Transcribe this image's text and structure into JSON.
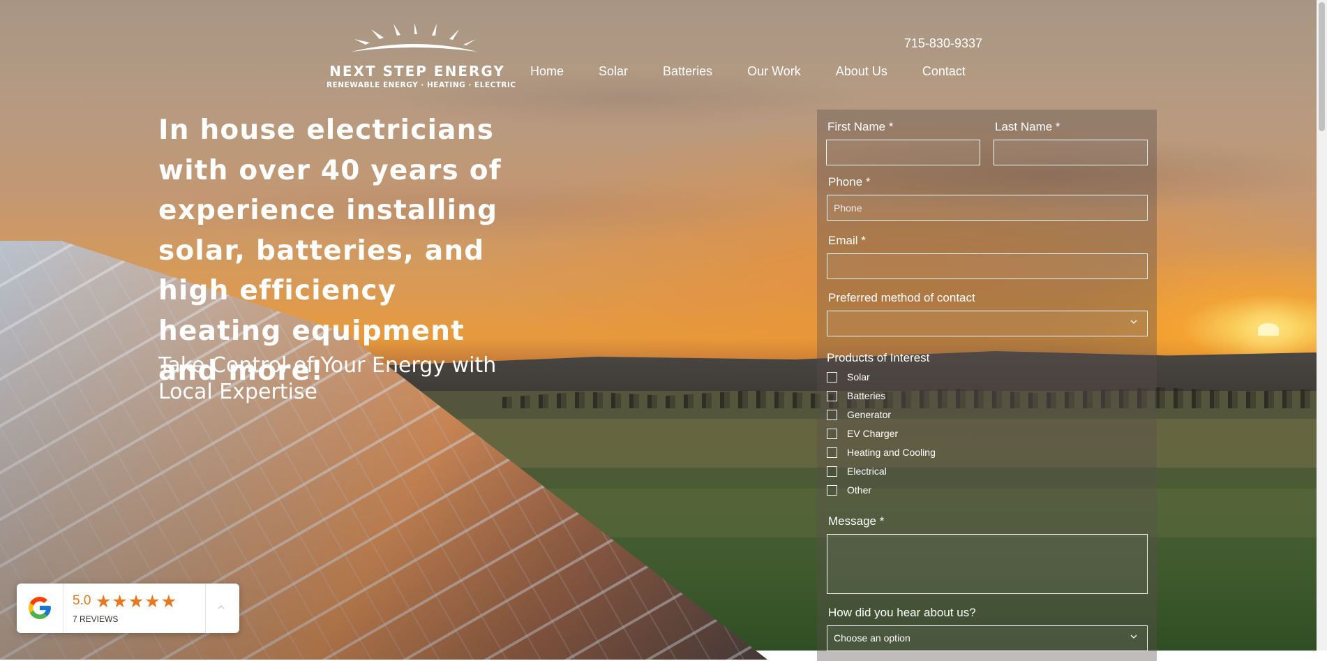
{
  "logo": {
    "title": "NEXT STEP ENERGY",
    "tagline": "RENEWABLE ENERGY · HEATING · ELECTRIC"
  },
  "header": {
    "phone": "715-830-9337",
    "nav": [
      "Home",
      "Solar",
      "Batteries",
      "Our Work",
      "About Us",
      "Contact"
    ]
  },
  "hero": {
    "title": "In house electricians with over 40 years of experience installing solar, batteries, and high efficiency heating equipment and more!",
    "subtitle": "Take Control of Your Energy with Local Expertise"
  },
  "form": {
    "first_name_label": "First Name *",
    "last_name_label": "Last Name *",
    "phone_label": "Phone *",
    "phone_placeholder": "Phone",
    "email_label": "Email *",
    "contact_method_label": "Preferred method of contact",
    "contact_method_value": "",
    "products_label": "Products of Interest",
    "products": [
      "Solar",
      "Batteries",
      "Generator",
      "EV Charger",
      "Heating and Cooling",
      "Electrical",
      "Other"
    ],
    "message_label": "Message *",
    "hear_label": "How did you hear about us?",
    "hear_value": "Choose an option"
  },
  "reviews": {
    "score": "5.0",
    "stars": "★★★★★",
    "count": "7 REVIEWS"
  },
  "colors": {
    "accent": "#e8771f",
    "text": "#ffffff"
  }
}
